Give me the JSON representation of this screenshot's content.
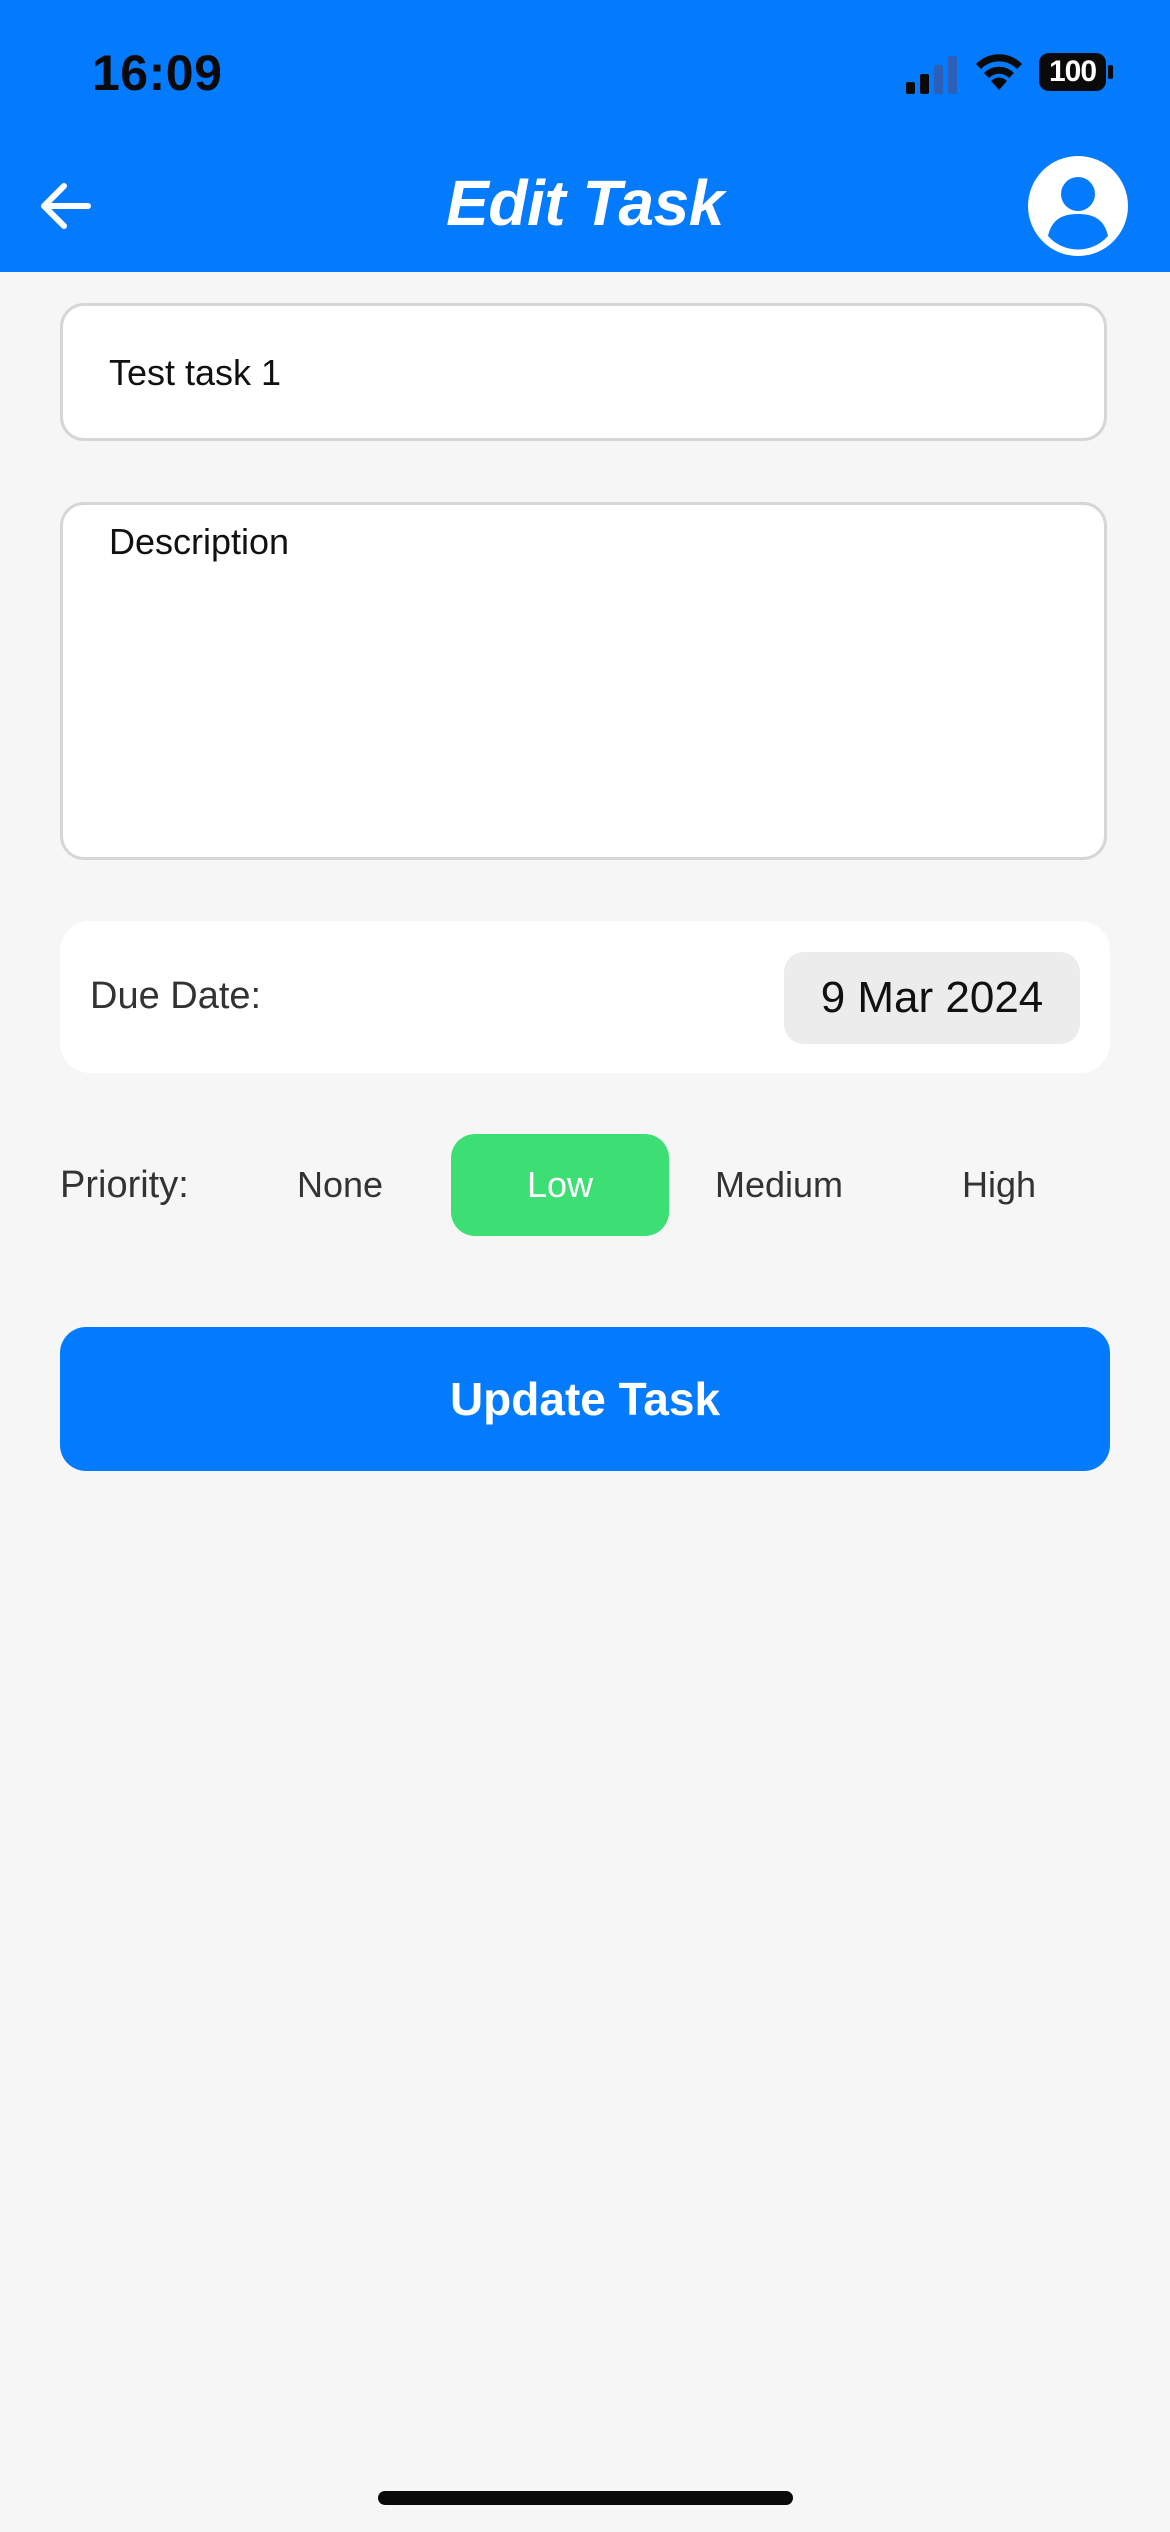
{
  "status_bar": {
    "time": "16:09",
    "battery": "100"
  },
  "header": {
    "title": "Edit Task",
    "background_color": "#047bfd"
  },
  "form": {
    "task_title": {
      "value": "Test task 1"
    },
    "description": {
      "placeholder": "Description"
    },
    "due_date": {
      "label": "Due Date:",
      "value": "9 Mar 2024"
    },
    "priority": {
      "label": "Priority:",
      "options": [
        "None",
        "Low",
        "Medium",
        "High"
      ],
      "selected": "Low",
      "selected_color": "#3ddf75"
    },
    "submit_label": "Update Task"
  }
}
